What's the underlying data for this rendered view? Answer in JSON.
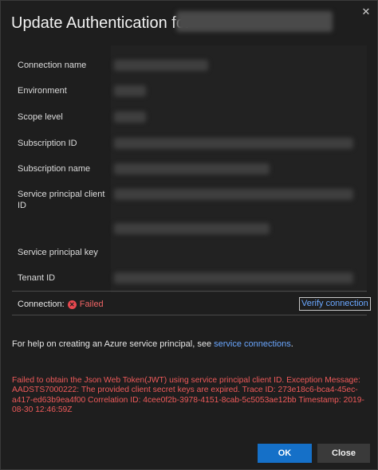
{
  "dialog": {
    "title": "Update Authentication for",
    "close_glyph": "✕"
  },
  "fields": [
    {
      "label": "Connection name"
    },
    {
      "label": "Environment"
    },
    {
      "label": "Scope level"
    },
    {
      "label": "Subscription ID"
    },
    {
      "label": "Subscription name"
    },
    {
      "label": "Service principal client ID"
    },
    {
      "label": "Service principal key"
    },
    {
      "label": "Tenant ID"
    }
  ],
  "connection": {
    "label": "Connection:",
    "status": "Failed",
    "status_color": "#ef6464",
    "verify_label": "Verify connection"
  },
  "help": {
    "text": "For help on creating an Azure service principal, see ",
    "link": "service connections",
    "suffix": "."
  },
  "error": {
    "message": "Failed to obtain the Json Web Token(JWT) using service principal client ID. Exception Message: AADSTS7000222: The provided client secret keys are expired. Trace ID: 273e18c6-bca4-45ec-a417-ed63b9ea4f00 Correlation ID: 4cee0f2b-3978-4151-8cab-5c5053ae12bb Timestamp: 2019-08-30 12:46:59Z"
  },
  "buttons": {
    "ok": "OK",
    "close": "Close"
  },
  "colors": {
    "accent": "#1570c8",
    "link": "#6aa7ff",
    "error": "#ef5a5a"
  }
}
